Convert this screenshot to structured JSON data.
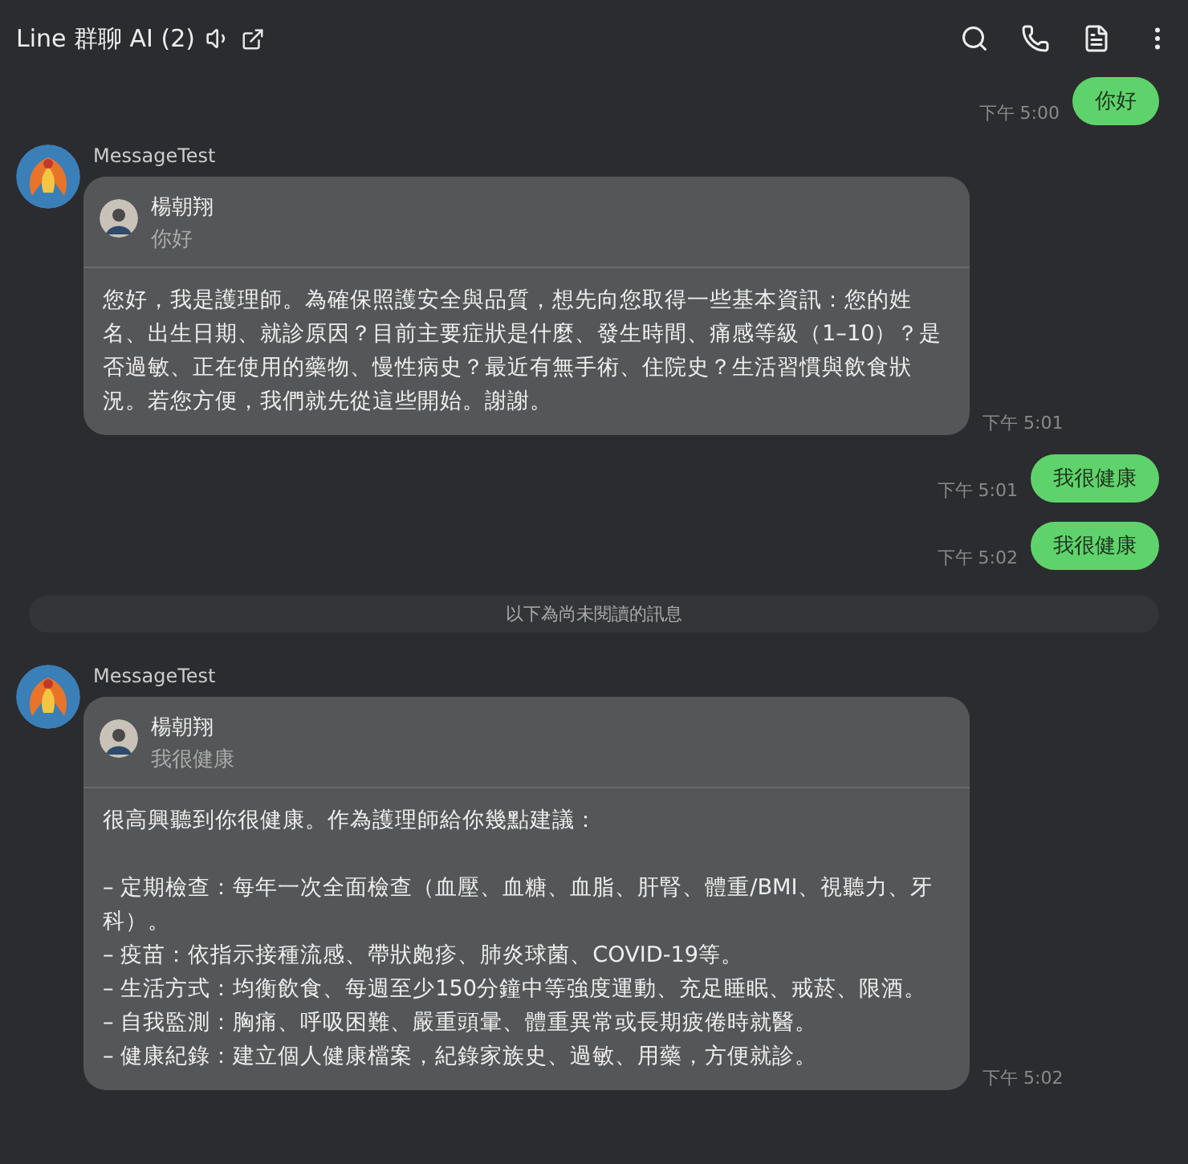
{
  "header": {
    "title": "Line 群聊 AI (2)"
  },
  "messages": [
    {
      "kind": "outgoing",
      "text": "你好",
      "time": "下午 5:00"
    },
    {
      "kind": "incoming",
      "sender": "MessageTest",
      "quote": {
        "author": "楊朝翔",
        "text": "你好"
      },
      "text": "您好，我是護理師。為確保照護安全與品質，想先向您取得一些基本資訊：您的姓名、出生日期、就診原因？目前主要症狀是什麼、發生時間、痛感等級（1–10）？是否過敏、正在使用的藥物、慢性病史？最近有無手術、住院史？生活習慣與飲食狀況。若您方便，我們就先從這些開始。謝謝。",
      "time": "下午 5:01"
    },
    {
      "kind": "outgoing",
      "text": "我很健康",
      "time": "下午 5:01"
    },
    {
      "kind": "outgoing",
      "text": "我很健康",
      "time": "下午 5:02"
    },
    {
      "kind": "divider",
      "text": "以下為尚未閱讀的訊息"
    },
    {
      "kind": "incoming",
      "sender": "MessageTest",
      "quote": {
        "author": "楊朝翔",
        "text": "我很健康"
      },
      "text": "很高興聽到你很健康。作為護理師給你幾點建議：\n\n– 定期檢查：每年一次全面檢查（血壓、血糖、血脂、肝腎、體重/BMI、視聽力、牙科）。\n– 疫苗：依指示接種流感、帶狀皰疹、肺炎球菌、COVID-19等。\n– 生活方式：均衡飲食、每週至少150分鐘中等強度運動、充足睡眠、戒菸、限酒。\n– 自我監測：胸痛、呼吸困難、嚴重頭暈、體重異常或長期疲倦時就醫。\n– 健康紀錄：建立個人健康檔案，紀錄家族史、過敏、用藥，方便就診。",
      "time": "下午 5:02"
    }
  ]
}
